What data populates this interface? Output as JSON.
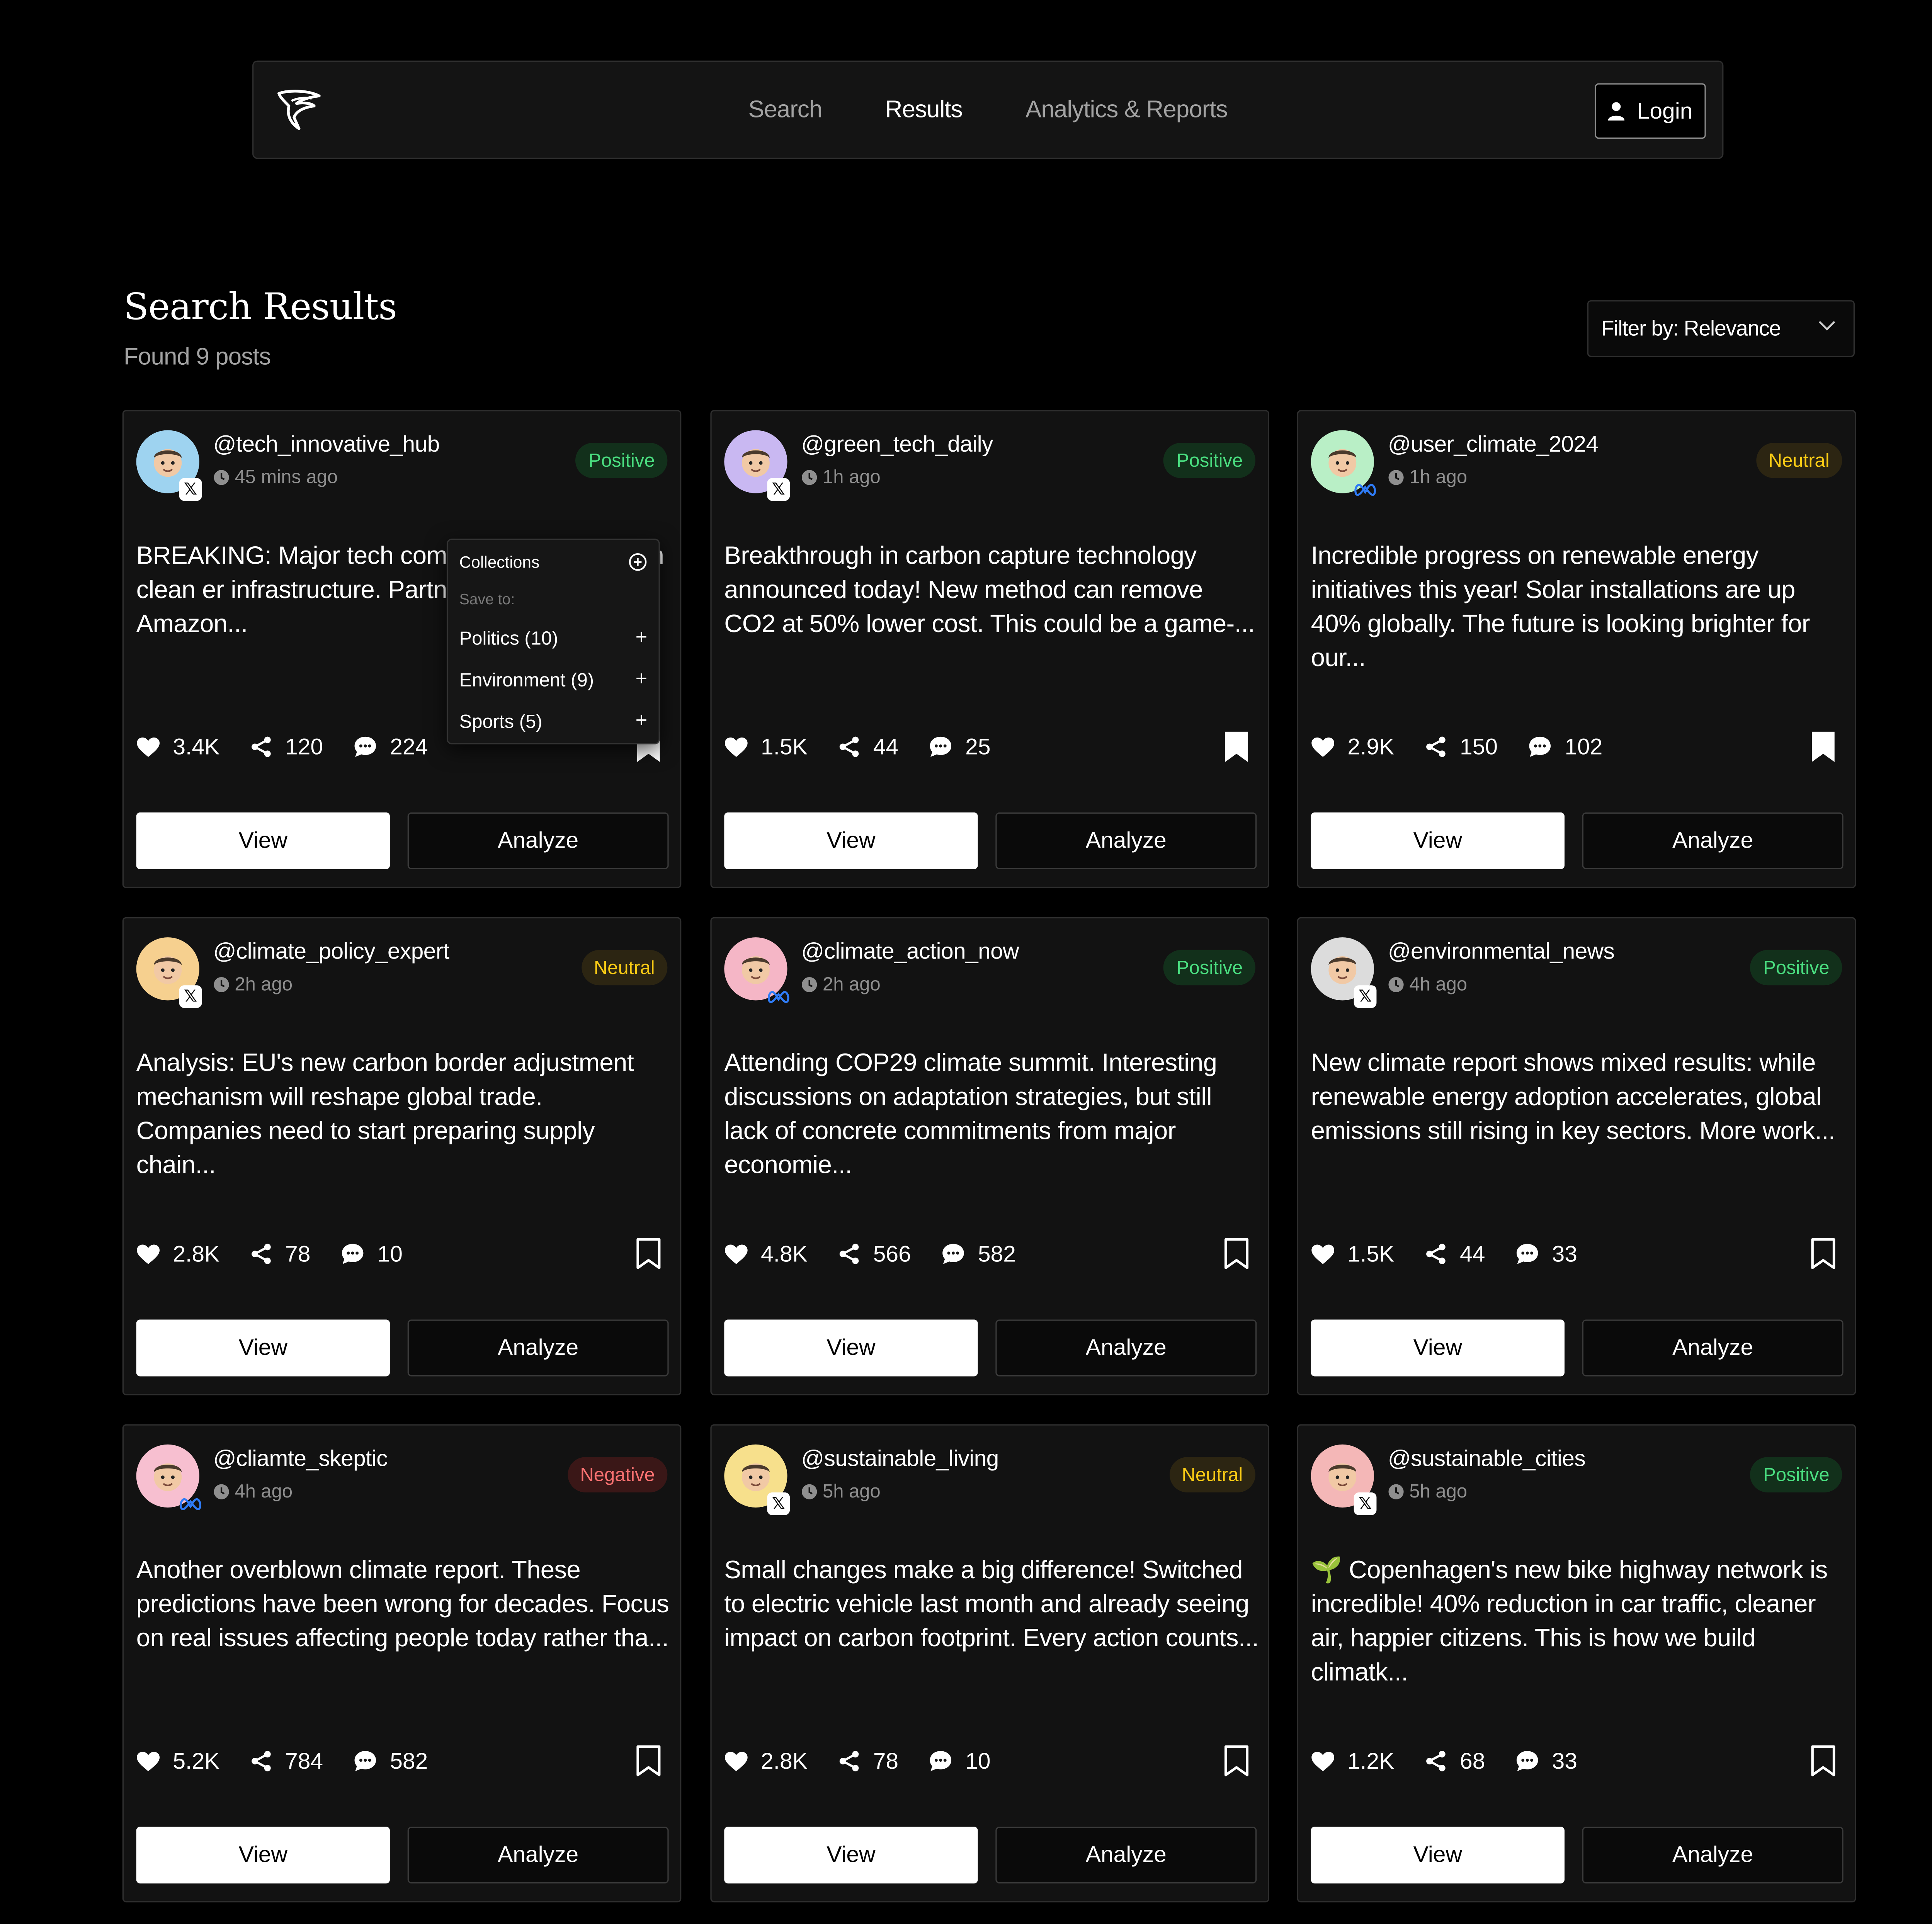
{
  "nav": {
    "links": [
      "Search",
      "Results",
      "Analytics & Reports"
    ],
    "login_label": "Login"
  },
  "page": {
    "title": "Search Results",
    "subtitle": "Found 9 posts",
    "filter_label": "Filter by: Relevance"
  },
  "collections_popup": {
    "title": "Collections",
    "save_to": "Save to:",
    "items": [
      "Politics (10)",
      "Environment (9)",
      "Sports (5)"
    ]
  },
  "buttons": {
    "view": "View",
    "analyze": "Analyze"
  },
  "posts": [
    {
      "handle": "@tech_innovative_hub",
      "time": "45 mins ago",
      "sentiment": "Positive",
      "platform": "x",
      "text": "BREAKING: Major tech com $50B investment in clean er infrastructure. Partnership i Microsoft, Amazon...",
      "likes": "3.4K",
      "shares": "120",
      "comments": "224",
      "saved": true
    },
    {
      "handle": "@green_tech_daily",
      "time": "1h ago",
      "sentiment": "Positive",
      "platform": "x",
      "text": "Breakthrough in carbon capture technology announced today! New method can remove CO2 at 50% lower cost. This could be a game-...",
      "likes": "1.5K",
      "shares": "44",
      "comments": "25",
      "saved": true
    },
    {
      "handle": "@user_climate_2024",
      "time": "1h ago",
      "sentiment": "Neutral",
      "platform": "meta",
      "text": "Incredible progress on renewable energy initiatives this year! Solar installations are up 40% globally. The future is looking brighter for our...",
      "likes": "2.9K",
      "shares": "150",
      "comments": "102",
      "saved": true
    },
    {
      "handle": "@climate_policy_expert",
      "time": "2h ago",
      "sentiment": "Neutral",
      "platform": "x",
      "text": "Analysis: EU's new carbon border adjustment mechanism will reshape global trade. Companies need to start preparing supply chain...",
      "likes": "2.8K",
      "shares": "78",
      "comments": "10",
      "saved": false
    },
    {
      "handle": "@climate_action_now",
      "time": "2h ago",
      "sentiment": "Positive",
      "platform": "meta",
      "text": "Attending COP29 climate summit. Interesting discussions on adaptation strategies, but still lack of concrete commitments from major economie...",
      "likes": "4.8K",
      "shares": "566",
      "comments": "582",
      "saved": false
    },
    {
      "handle": "@environmental_news",
      "time": "4h ago",
      "sentiment": "Positive",
      "platform": "x",
      "text": "New climate report shows mixed results: while renewable energy adoption accelerates, global emissions still rising in key sectors. More work...",
      "likes": "1.5K",
      "shares": "44",
      "comments": "33",
      "saved": false
    },
    {
      "handle": "@cliamte_skeptic",
      "time": "4h ago",
      "sentiment": "Negative",
      "platform": "meta",
      "text": "Another overblown climate report. These predictions have been wrong for decades. Focus on real issues affecting people today rather tha...",
      "likes": "5.2K",
      "shares": "784",
      "comments": "582",
      "saved": false
    },
    {
      "handle": "@sustainable_living",
      "time": "5h ago",
      "sentiment": "Neutral",
      "platform": "x",
      "text": "Small changes make a big difference! Switched to electric vehicle last month and already seeing impact on carbon footprint. Every action counts...",
      "likes": "2.8K",
      "shares": "78",
      "comments": "10",
      "saved": false
    },
    {
      "handle": "@sustainable_cities",
      "time": "5h ago",
      "sentiment": "Positive",
      "platform": "x",
      "text": "🌱 Copenhagen's new bike highway network is incredible! 40% reduction in car traffic, cleaner air, happier citizens. This is how we build climatk...",
      "likes": "1.2K",
      "shares": "68",
      "comments": "33",
      "saved": false
    }
  ],
  "avatar_colors": [
    "#9ed3f0",
    "#c9b8f2",
    "#b9efc6",
    "#f6d08f",
    "#f5b6c6",
    "#dcdcdc",
    "#f7bfd0",
    "#f7e08c",
    "#f4b7b7"
  ],
  "platform_icons": {
    "x": "x-logo-icon",
    "meta": "meta-logo-icon"
  }
}
